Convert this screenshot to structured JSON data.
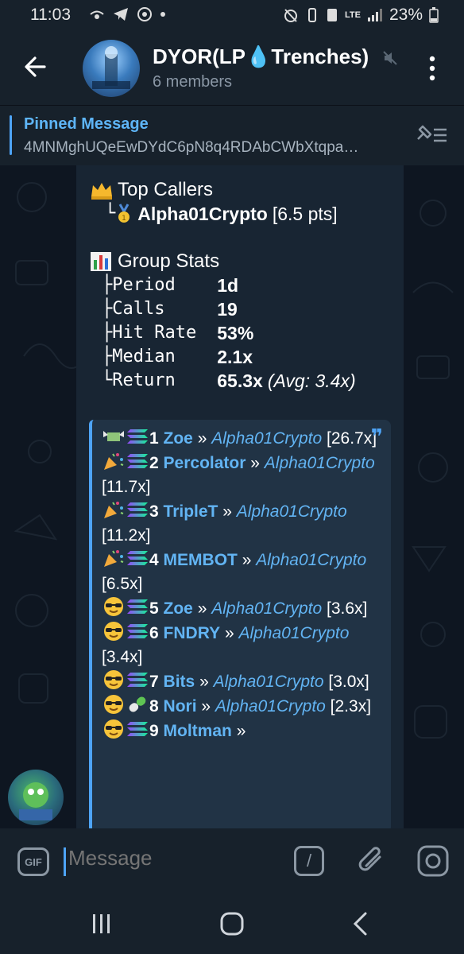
{
  "status": {
    "time": "11:03",
    "network": "LTE",
    "battery": "23%"
  },
  "header": {
    "title": "DYOR(LP💧Trenches)",
    "subtitle": "6 members"
  },
  "pinned": {
    "title": "Pinned Message",
    "text": "4MNMghUQeEwDYdC6pN8q4RDAbCWbXtqpa…"
  },
  "message": {
    "top_callers_title": "Top Callers",
    "top_caller": {
      "prefix": "└",
      "name": "Alpha01Crypto",
      "pts": "[6.5 pts]"
    },
    "group_stats_title": "Group Stats",
    "stats": [
      {
        "branch": "├",
        "label": "Period  ",
        "value": "1d",
        "extra": ""
      },
      {
        "branch": "├",
        "label": "Calls   ",
        "value": "19",
        "extra": ""
      },
      {
        "branch": "├",
        "label": "Hit Rate",
        "value": "53%",
        "extra": ""
      },
      {
        "branch": "├",
        "label": "Median  ",
        "value": "2.1x",
        "extra": ""
      },
      {
        "branch": "└",
        "label": "Return  ",
        "value": "65.3x",
        "extra": "(Avg: 3.4x)"
      }
    ],
    "calls": [
      {
        "rank": "1",
        "token": "Zoe",
        "caller": "Alpha01Crypto",
        "mult": "[26.7x]",
        "emoji": "money",
        "chain": "sol"
      },
      {
        "rank": "2",
        "token": "Percolator",
        "caller": "Alpha01Crypto",
        "mult": "[11.7x]",
        "emoji": "party",
        "chain": "sol"
      },
      {
        "rank": "3",
        "token": "TripleT",
        "caller": "Alpha01Crypto",
        "mult": "[11.2x]",
        "emoji": "party",
        "chain": "sol"
      },
      {
        "rank": "4",
        "token": "MEMBOT",
        "caller": "Alpha01Crypto",
        "mult": "[6.5x]",
        "emoji": "party",
        "chain": "sol"
      },
      {
        "rank": "5",
        "token": "Zoe",
        "caller": "Alpha01Crypto",
        "mult": "[3.6x]",
        "emoji": "cool",
        "chain": "sol"
      },
      {
        "rank": "6",
        "token": "FNDRY",
        "caller": "Alpha01Crypto",
        "mult": "[3.4x]",
        "emoji": "cool",
        "chain": "sol"
      },
      {
        "rank": "7",
        "token": "Bits",
        "caller": "Alpha01Crypto",
        "mult": "[3.0x]",
        "emoji": "cool",
        "chain": "sol"
      },
      {
        "rank": "8",
        "token": "Nori",
        "caller": "Alpha01Crypto",
        "mult": "[2.3x]",
        "emoji": "cool",
        "chain": "pill"
      },
      {
        "rank": "9",
        "token": "Moltman",
        "caller": "",
        "mult": "",
        "emoji": "cool",
        "chain": "sol"
      }
    ],
    "separator": "»"
  },
  "composer": {
    "placeholder": "Message",
    "gif_label": "GIF",
    "command_label": "/"
  },
  "colors": {
    "accent": "#4ea4f6",
    "link": "#62b4f3",
    "bg": "#0e1621",
    "panel": "#17212b",
    "bubble": "#182533"
  }
}
